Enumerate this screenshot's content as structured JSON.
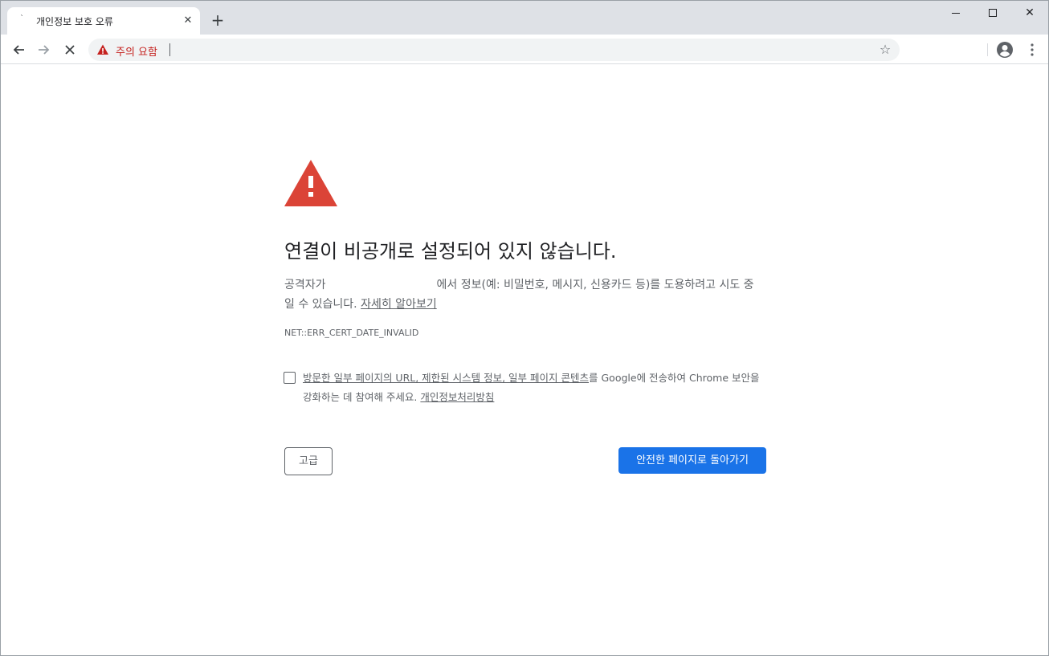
{
  "tab": {
    "title": "개인정보 보호 오류",
    "favicon": "loading-icon",
    "close_icon": "close-icon"
  },
  "new_tab_icon": "plus-icon",
  "window_controls": [
    "minimize-icon",
    "maximize-icon",
    "close-icon"
  ],
  "toolbar": {
    "back_icon": "arrow-left-icon",
    "forward_icon": "arrow-right-icon",
    "stop_icon": "stop-icon",
    "security_label": "주의 요함",
    "star_icon": "star-icon",
    "profile_icon": "account-circle-icon",
    "menu_icon": "more-vert-icon"
  },
  "page": {
    "heading": "연결이 비공개로 설정되어 있지 않습니다.",
    "explanation_before": "공격자가",
    "explanation_after": "에서 정보(예: 비밀번호, 메시지, 신용카드 등)를 도용하려고 시도 중일 수 있습니다.",
    "learn_more": "자세히 알아보기",
    "error_code": "NET::ERR_CERT_DATE_INVALID",
    "optin_link1": "방문한 일부 페이지의 URL, 제한된 시스템 정보, 일부 페이지 콘텐츠",
    "optin_middle": "를 Google에 전송하여 Chrome 보안을 강화하는 데 참여해 주세요.",
    "optin_link2": "개인정보처리방침",
    "optin_checked": false,
    "advanced_button": "고급",
    "back_button": "안전한 페이지로 돌아가기"
  },
  "colors": {
    "warning_red": "#db4437",
    "omnibox_warning": "#c5221f",
    "primary_button": "#1a73e8"
  }
}
